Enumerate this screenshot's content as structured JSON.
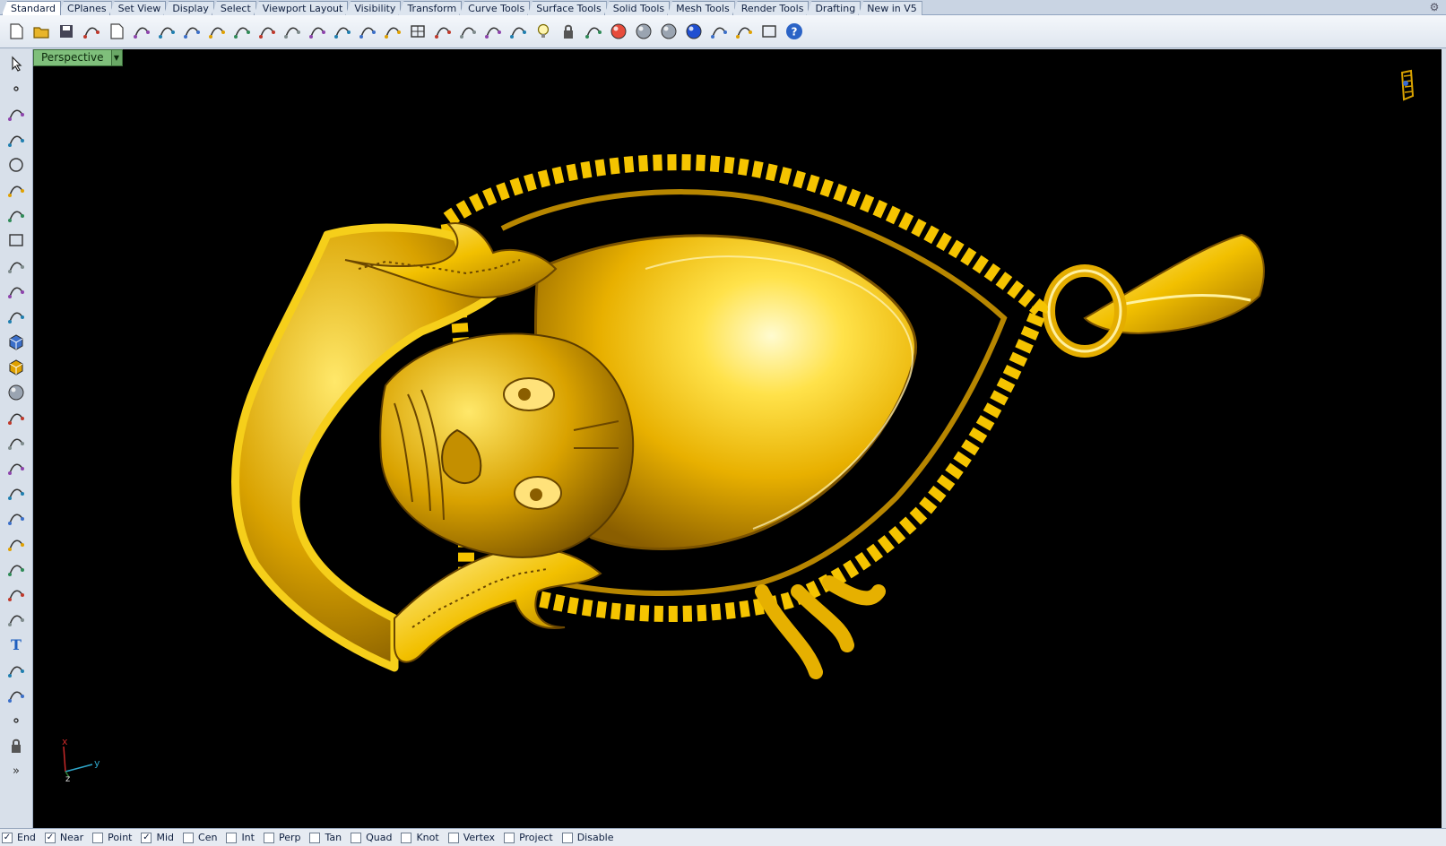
{
  "tabs": [
    "Standard",
    "CPlanes",
    "Set View",
    "Display",
    "Select",
    "Viewport Layout",
    "Visibility",
    "Transform",
    "Curve Tools",
    "Surface Tools",
    "Solid Tools",
    "Mesh Tools",
    "Render Tools",
    "Drafting",
    "New in V5"
  ],
  "active_tab": "Standard",
  "toolbar_icons": [
    "new-file-icon",
    "open-file-icon",
    "save-icon",
    "print-icon",
    "import-icon",
    "cut-icon",
    "copy-icon",
    "paste-icon",
    "undo-icon",
    "pan-hand-icon",
    "rotate-view-icon",
    "zoom-icon",
    "zoom-window-icon",
    "zoom-extents-icon",
    "zoom-selected-icon",
    "rotate-icon",
    "four-viewports-icon",
    "car-render-icon",
    "hide-icon",
    "show-icon",
    "object-snap-icon",
    "light-bulb-icon",
    "lock-icon",
    "layer-icon",
    "color-wheel-icon",
    "shaded-sphere-icon",
    "render-sphere-icon",
    "blue-sphere-icon",
    "paint-brush-icon",
    "gear-options-icon",
    "grid-snap-icon",
    "help-icon"
  ],
  "sidebar_icons": [
    "select-arrow-icon",
    "point-icon",
    "polyline-icon",
    "curve-icon",
    "circle-icon",
    "arc-icon",
    "polygon-icon",
    "rectangle-icon",
    "ellipse-icon",
    "fillet-curve-icon",
    "surface-icon",
    "extrude-icon",
    "box-solid-icon",
    "sphere-solid-icon",
    "cylinder-solid-icon",
    "mesh-icon",
    "explode-icon",
    "trim-icon",
    "split-icon",
    "boolean-union-icon",
    "array-icon",
    "rebuild-icon",
    "blend-icon",
    "text-icon",
    "dimension-icon",
    "group-icon",
    "edit-points-icon",
    "block-icon",
    "expand-icon"
  ],
  "viewport": {
    "title": "Perspective",
    "dropdown_symbol": "▼",
    "axes": {
      "x": "x",
      "y": "y",
      "z": "z"
    }
  },
  "osnaps": [
    {
      "label": "End",
      "checked": true
    },
    {
      "label": "Near",
      "checked": true
    },
    {
      "label": "Point",
      "checked": false
    },
    {
      "label": "Mid",
      "checked": true
    },
    {
      "label": "Cen",
      "checked": false
    },
    {
      "label": "Int",
      "checked": false
    },
    {
      "label": "Perp",
      "checked": false
    },
    {
      "label": "Tan",
      "checked": false
    },
    {
      "label": "Quad",
      "checked": false
    },
    {
      "label": "Knot",
      "checked": false
    },
    {
      "label": "Vertex",
      "checked": false
    },
    {
      "label": "Project",
      "checked": false
    },
    {
      "label": "Disable",
      "checked": false
    }
  ],
  "colors": {
    "viewport_bg": "#000000",
    "gold": "#f5c400",
    "gold_dark": "#8a5e00",
    "viewport_label": "#7fbf7b"
  }
}
